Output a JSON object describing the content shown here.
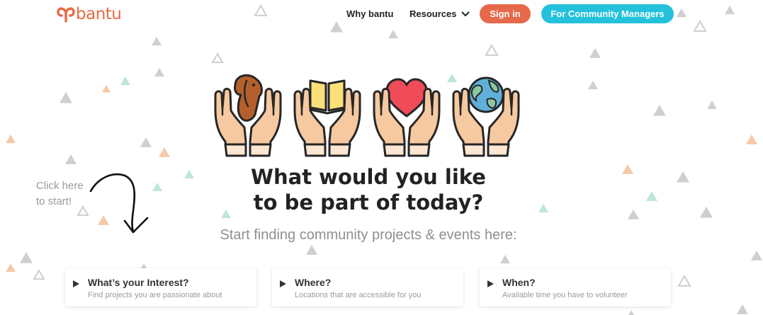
{
  "brand": {
    "logo_text": "bantu",
    "color": "#e86a42"
  },
  "nav": {
    "why_label": "Why bantu",
    "resources_label": "Resources",
    "signin_label": "Sign in",
    "cm_label": "For Community Managers"
  },
  "hero": {
    "title_line1": "What would you like",
    "title_line2": "to be part of today?",
    "hint_line1": "Click here",
    "hint_line2": "to start!",
    "subtitle": "Start finding community projects & events here:",
    "icons": [
      "dog-in-hands-icon",
      "book-in-hands-icon",
      "heart-in-hands-icon",
      "globe-in-hands-icon"
    ]
  },
  "cards": [
    {
      "title": "What’s your Interest?",
      "desc": "Find projects you are passionate about"
    },
    {
      "title": "Where?",
      "desc": "Locations that are accessible for you"
    },
    {
      "title": "When?",
      "desc": "Available time you have to volunteer"
    }
  ],
  "colors": {
    "signin": "#e5694a",
    "community_managers": "#24c1dc",
    "triangle_gray": "#cfcfcf",
    "triangle_orange": "#f6c9a8",
    "triangle_teal": "#bfe6d7"
  }
}
